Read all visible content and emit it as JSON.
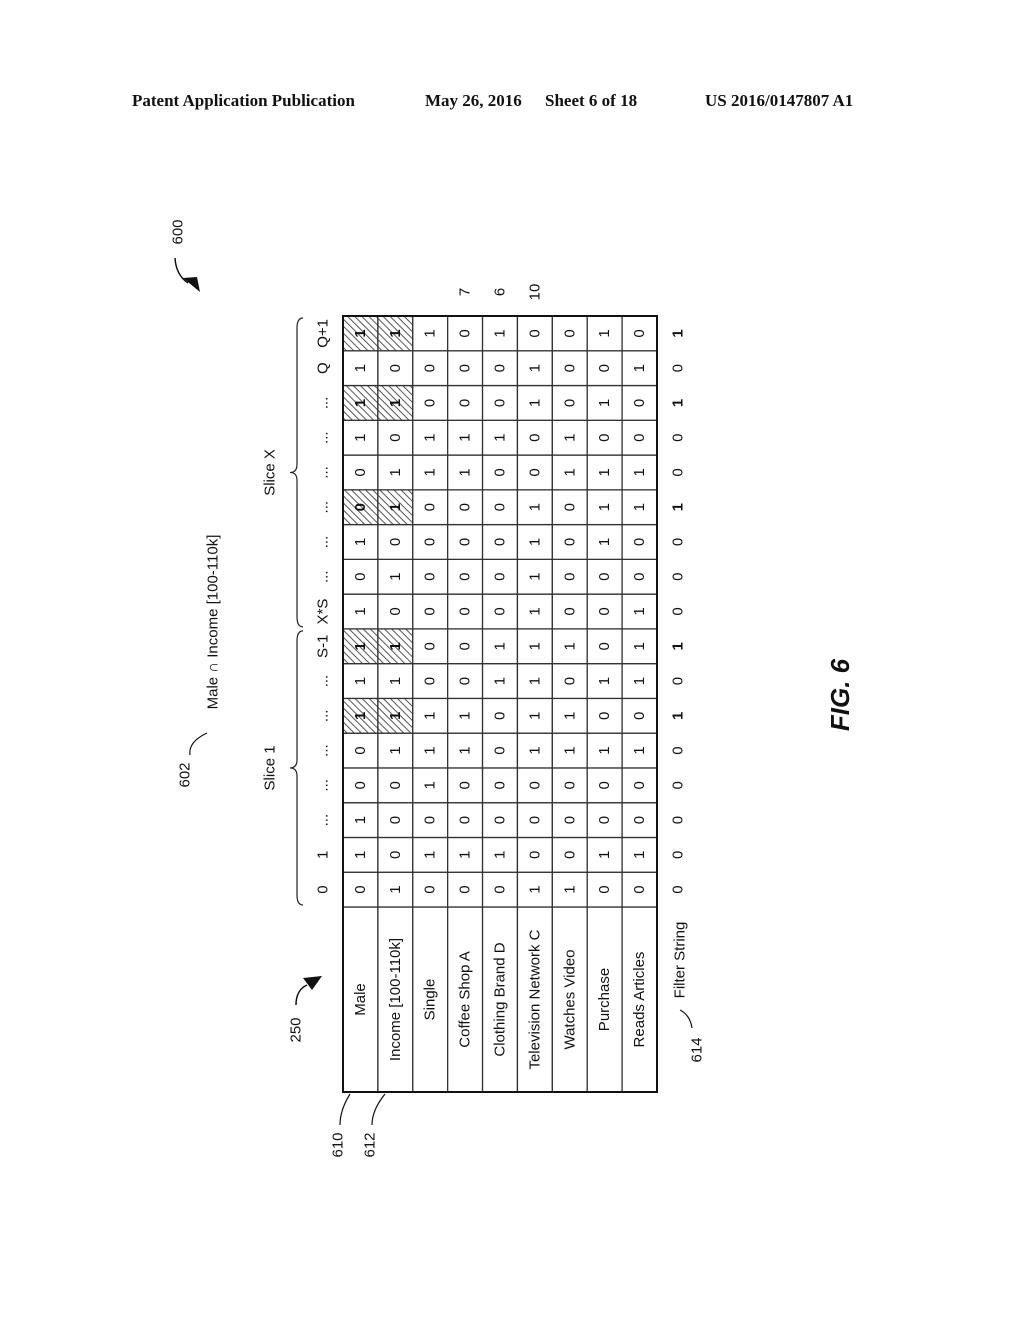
{
  "header": {
    "publication": "Patent Application Publication",
    "date": "May 26, 2016",
    "sheet": "Sheet 6 of 18",
    "number": "US 2016/0147807 A1"
  },
  "figure": {
    "label": "FIG. 6",
    "ref_figure": "600",
    "ref_bitmap": "250",
    "ref_query": "602",
    "query_label": "Male ∩ Income [100-110k]",
    "ref_row_male": "610",
    "ref_row_income": "612",
    "ref_filter": "614",
    "filter_label": "Filter String",
    "slices": [
      {
        "label": "Slice 1"
      },
      {
        "label": "Slice X"
      }
    ],
    "column_headers": [
      "0",
      "1",
      "...",
      "...",
      "...",
      "...",
      "...",
      "S-1",
      "X*S",
      "...",
      "...",
      "...",
      "...",
      "...",
      "...",
      "Q",
      "Q+1"
    ],
    "row_labels": [
      "Male",
      "Income [100-110k]",
      "Single",
      "Coffee Shop A",
      "Clothing Brand D",
      "Television Network C",
      "Watches Video",
      "Purchase",
      "Reads Articles"
    ],
    "rows": [
      [
        0,
        1,
        1,
        0,
        0,
        1,
        1,
        1,
        1,
        0,
        1,
        0,
        0,
        1,
        1,
        1,
        1
      ],
      [
        1,
        0,
        0,
        0,
        1,
        1,
        1,
        1,
        0,
        1,
        0,
        1,
        1,
        0,
        1,
        0,
        1
      ],
      [
        0,
        1,
        0,
        1,
        1,
        1,
        0,
        0,
        0,
        0,
        0,
        0,
        1,
        1,
        0,
        0,
        1
      ],
      [
        0,
        1,
        0,
        0,
        1,
        1,
        0,
        0,
        0,
        0,
        0,
        0,
        1,
        1,
        0,
        0,
        0
      ],
      [
        0,
        1,
        0,
        0,
        0,
        0,
        1,
        1,
        0,
        0,
        0,
        0,
        0,
        1,
        0,
        0,
        1
      ],
      [
        1,
        0,
        0,
        0,
        1,
        1,
        1,
        1,
        1,
        1,
        1,
        1,
        0,
        0,
        1,
        1,
        0
      ],
      [
        1,
        0,
        0,
        0,
        1,
        1,
        0,
        1,
        0,
        0,
        0,
        0,
        1,
        1,
        0,
        0,
        0
      ],
      [
        0,
        1,
        0,
        0,
        1,
        0,
        1,
        0,
        0,
        0,
        1,
        1,
        1,
        0,
        1,
        0,
        1
      ],
      [
        0,
        1,
        0,
        0,
        1,
        0,
        1,
        1,
        1,
        0,
        0,
        1,
        1,
        0,
        0,
        1,
        0
      ]
    ],
    "highlighted_columns": [
      5,
      7,
      11,
      14,
      16
    ],
    "highlighted_rows": [
      0,
      1
    ],
    "filter_string": [
      0,
      0,
      0,
      0,
      0,
      1,
      0,
      1,
      0,
      0,
      0,
      1,
      0,
      0,
      1,
      0,
      1
    ],
    "side_counts": [
      {
        "row": "Coffee Shop A",
        "value": "7"
      },
      {
        "row": "Clothing Brand D",
        "value": "6"
      },
      {
        "row": "Television Network C",
        "value": "10"
      }
    ]
  }
}
